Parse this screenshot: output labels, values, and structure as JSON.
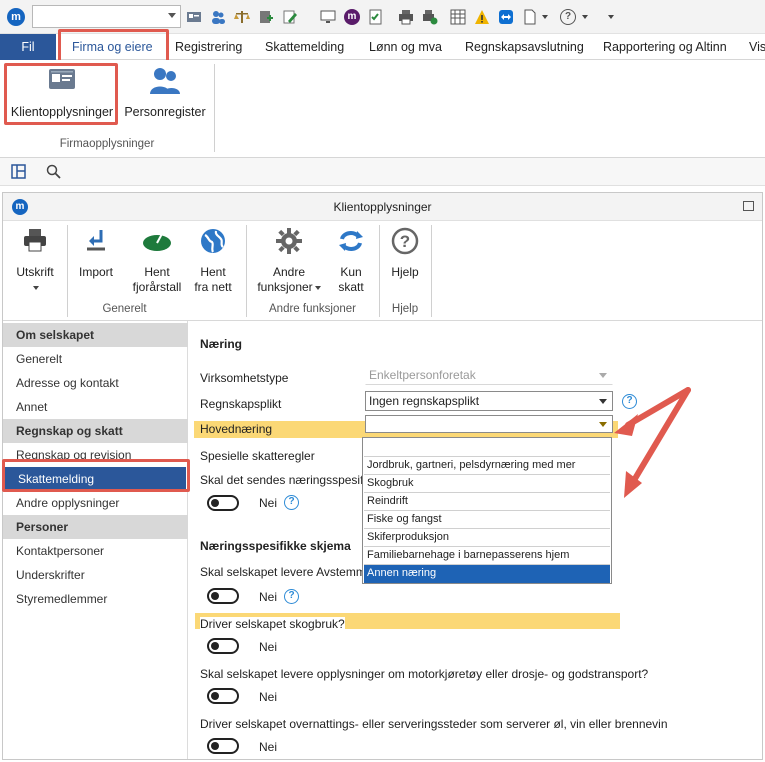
{
  "ribbon_tabs": {
    "fil": "Fil",
    "firma": "Firma og eiere",
    "registrering": "Registrering",
    "skattemelding": "Skattemelding",
    "lonn": "Lønn og mva",
    "regnskapsavslutning": "Regnskapsavslutning",
    "rapportering": "Rapportering og Altinn",
    "vis": "Vis"
  },
  "ribbon": {
    "klientopplysninger": "Klientopplysninger",
    "personregister": "Personregister",
    "group_label": "Firmaopplysninger"
  },
  "window": {
    "title": "Klientopplysninger"
  },
  "toolbar": {
    "utskrift": "Utskrift",
    "import": "Import",
    "hent_fjorar_1": "Hent",
    "hent_fjorar_2": "fjorårstall",
    "hent_nett_1": "Hent",
    "hent_nett_2": "fra nett",
    "andre_1": "Andre",
    "andre_2": "funksjoner",
    "kun_1": "Kun",
    "kun_2": "skatt",
    "hjelp": "Hjelp",
    "group_generelt": "Generelt",
    "group_andre": "Andre funksjoner",
    "group_hjelp": "Hjelp"
  },
  "sidebar": {
    "sections": [
      {
        "header": "Om selskapet",
        "items": [
          "Generelt",
          "Adresse og kontakt",
          "Annet"
        ]
      },
      {
        "header": "Regnskap og skatt",
        "items": [
          "Regnskap og revisjon",
          "Skattemelding",
          "Andre opplysninger"
        ]
      },
      {
        "header": "Personer",
        "items": [
          "Kontaktpersoner",
          "Underskrifter",
          "Styremedlemmer"
        ]
      }
    ],
    "selected": "Skattemelding"
  },
  "main": {
    "section_naering": "Næring",
    "virksomhetstype_label": "Virksomhetstype",
    "virksomhetstype_value": "Enkeltpersonforetak",
    "regnskapsplikt_label": "Regnskapsplikt",
    "regnskapsplikt_value": "Ingen regnskapsplikt",
    "hovednaering_label": "Hovednæring",
    "hovednaering_value": "",
    "spesielle_label": "Spesielle skatteregler",
    "naeringsspesifikasjon_label": "Skal det sendes næringsspesifik",
    "nei": "Nei",
    "section_skjema": "Næringsspesifikke skjema",
    "q_avstemming": "Skal selskapet levere Avstemmin",
    "q_skogbruk": "Driver selskapet skogbruk?",
    "q_motorkjoretoy": "Skal selskapet levere opplysninger om motorkjøretøy eller drosje- og godstransport?",
    "q_overnatting": "Driver selskapet overnattings- eller serveringssteder som serverer øl, vin eller brennevin"
  },
  "dropdown": {
    "options": [
      "",
      "Jordbruk, gartneri, pelsdyrnæring med mer",
      "Skogbruk",
      "Reindrift",
      "Fiske og fangst",
      "Skiferproduksjon",
      "Familiebarnehage i barnepasserens hjem",
      "Annen næring"
    ],
    "highlighted": "Annen næring"
  },
  "colors": {
    "accent": "#2b579a",
    "highlight_row": "#fbd876",
    "annotation_red": "#e05a4f",
    "selected_option": "#1e63b5"
  }
}
